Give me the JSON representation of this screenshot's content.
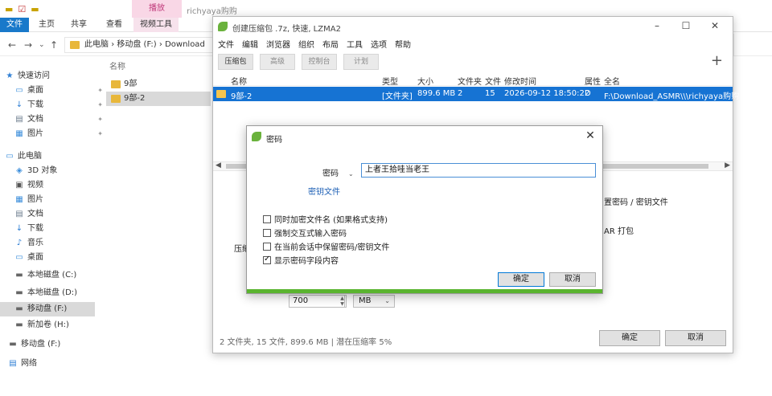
{
  "explorer": {
    "context_tab": "播放",
    "window_title": "richyaya购购",
    "ribbon_tabs": [
      "文件",
      "主页",
      "共享",
      "查看",
      "视频工具"
    ],
    "address_parts": [
      "此电脑",
      "移动盘 (F:)",
      "Download"
    ],
    "nav_items": [
      {
        "label": "快速访问",
        "icon": "star-icon"
      },
      {
        "label": "桌面",
        "icon": "desktop-icon",
        "pinned": true
      },
      {
        "label": "下载",
        "icon": "download-icon",
        "pinned": true
      },
      {
        "label": "文档",
        "icon": "document-icon",
        "pinned": true
      },
      {
        "label": "图片",
        "icon": "picture-icon",
        "pinned": true
      },
      {
        "label": "此电脑",
        "icon": "computer-icon"
      },
      {
        "label": "3D 对象",
        "icon": "cube-icon"
      },
      {
        "label": "视频",
        "icon": "video-icon"
      },
      {
        "label": "图片",
        "icon": "picture-icon"
      },
      {
        "label": "文档",
        "icon": "document-icon"
      },
      {
        "label": "下载",
        "icon": "download-icon"
      },
      {
        "label": "音乐",
        "icon": "music-icon"
      },
      {
        "label": "桌面",
        "icon": "desktop-icon"
      },
      {
        "label": "本地磁盘 (C:)",
        "icon": "drive-icon"
      },
      {
        "label": "本地磁盘 (D:)",
        "icon": "drive-icon"
      },
      {
        "label": "移动盘 (F:)",
        "icon": "usb-drive-icon",
        "selected": true
      },
      {
        "label": "新加卷 (H:)",
        "icon": "drive-icon"
      },
      {
        "label": "移动盘 (F:)",
        "icon": "usb-drive-icon"
      },
      {
        "label": "网络",
        "icon": "network-icon"
      }
    ],
    "list_header": "名称",
    "list_items": [
      {
        "label": "9部",
        "selected": false
      },
      {
        "label": "9部-2",
        "selected": true
      }
    ]
  },
  "zip": {
    "title": "创建压缩包 .7z, 快速, LZMA2",
    "menu": [
      "文件",
      "编辑",
      "浏览器",
      "组织",
      "布局",
      "工具",
      "选项",
      "帮助"
    ],
    "tabs": [
      "压缩包",
      "高级",
      "控制台",
      "计划"
    ],
    "columns": [
      "名称",
      "类型",
      "大小",
      "文件夹",
      "文件",
      "修改时间",
      "属性",
      "全名"
    ],
    "row": {
      "name": "9部-2",
      "type": "[文件夹]",
      "size": "899.6 MB",
      "folders": "2",
      "files": "15",
      "modified": "2026-09-12 18:50:22",
      "attr": "D",
      "fullname": "F:\\Download_ASMR\\\\\\richyaya购购"
    },
    "side_text_1": "置密码 / 密钥文件",
    "side_text_2": "AR 打包",
    "left_label": "压缩",
    "split_value": "700",
    "split_unit": "MB",
    "status": "2 文件夹, 15 文件, 899.6 MB | 潜在压缩率 5%",
    "ok_label": "确定",
    "cancel_label": "取消"
  },
  "dialog": {
    "title": "密码",
    "password_label": "密码",
    "password_value": "上者王拾哇当老王",
    "keyfile_link": "密钥文件",
    "options": [
      {
        "label": "同时加密文件名 (如果格式支持)",
        "checked": false
      },
      {
        "label": "强制交互式输入密码",
        "checked": false
      },
      {
        "label": "在当前会话中保留密码/密钥文件",
        "checked": false
      },
      {
        "label": "显示密码字段内容",
        "checked": true
      }
    ],
    "ok_label": "确定",
    "cancel_label": "取消"
  }
}
